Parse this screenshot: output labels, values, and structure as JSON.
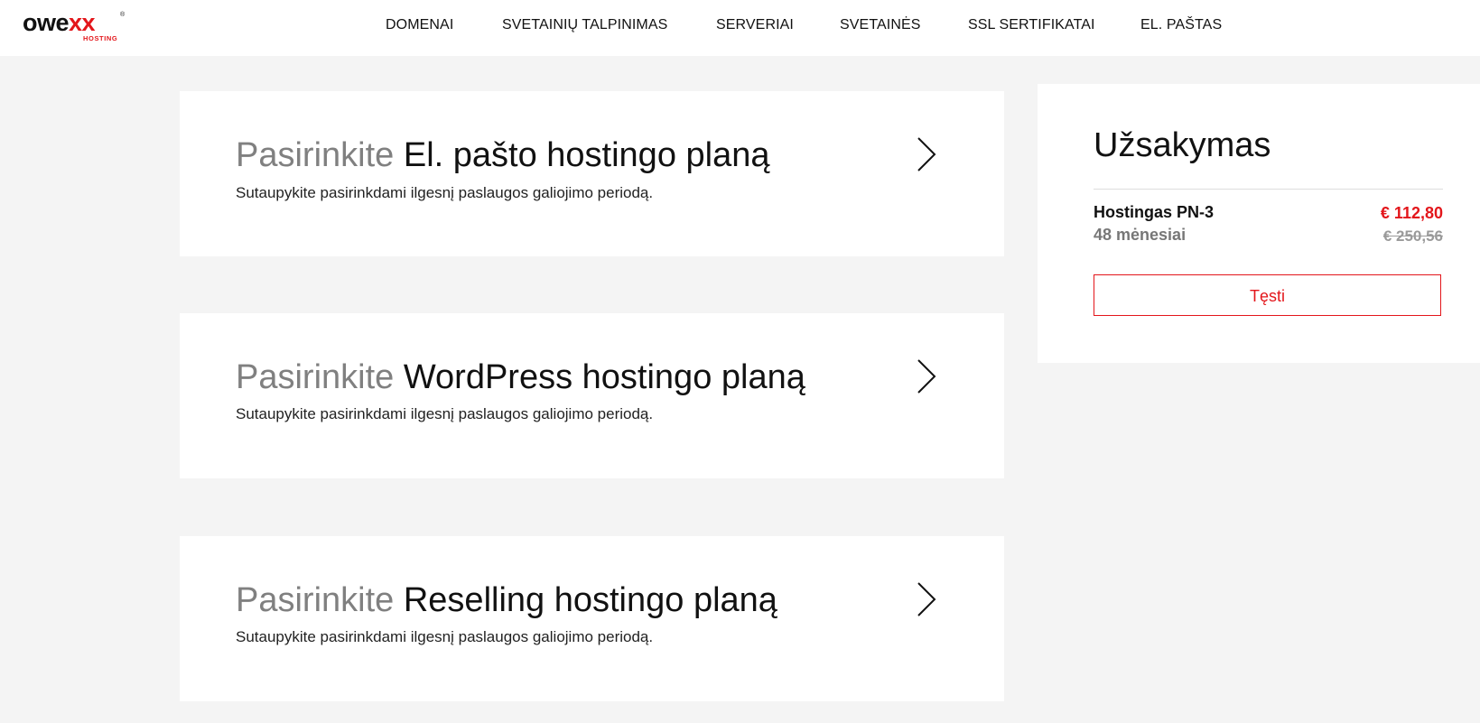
{
  "header": {
    "logo": {
      "word_main": "owe",
      "word_accent": "xx",
      "registered": "®",
      "sub": "HOSTING"
    },
    "nav": [
      {
        "label": "DOMENAI"
      },
      {
        "label": "SVETAINIŲ TALPINIMAS"
      },
      {
        "label": "SERVERIAI"
      },
      {
        "label": "SVETAINĖS"
      },
      {
        "label": "SSL SERTIFIKATAI"
      },
      {
        "label": "EL. PAŠTAS"
      }
    ]
  },
  "plans": [
    {
      "prefix": "Pasirinkite",
      "title": "El. pašto hostingo planą",
      "subtitle": "Sutaupykite pasirinkdami ilgesnį paslaugos galiojimo periodą.",
      "icon": "chevron-right-icon"
    },
    {
      "prefix": "Pasirinkite",
      "title": "WordPress hostingo planą",
      "subtitle": "Sutaupykite pasirinkdami ilgesnį paslaugos galiojimo periodą.",
      "icon": "chevron-right-icon"
    },
    {
      "prefix": "Pasirinkite",
      "title": "Reselling hostingo planą",
      "subtitle": "Sutaupykite pasirinkdami ilgesnį paslaugos galiojimo periodą.",
      "icon": "chevron-right-icon"
    }
  ],
  "order": {
    "title": "Užsakymas",
    "item_name": "Hostingas PN-3",
    "item_period": "48 mėnesiai",
    "price": "€ 112,80",
    "old_price": "€ 250,56",
    "continue_label": "Tęsti"
  },
  "colors": {
    "accent": "#e3161b",
    "background": "#f4f4f4",
    "muted": "#808080"
  }
}
